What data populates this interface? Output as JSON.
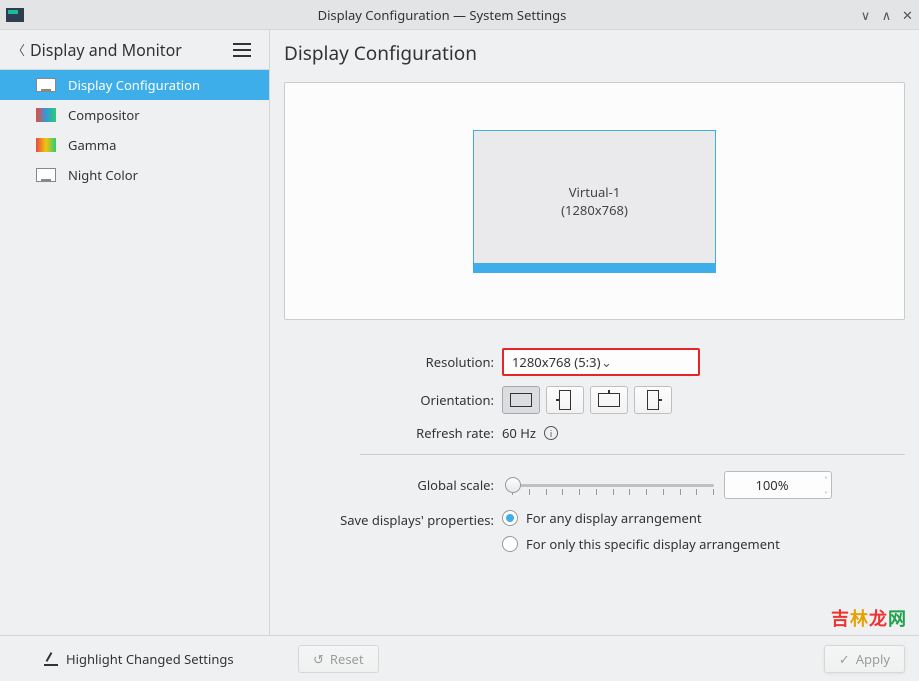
{
  "window": {
    "title": "Display Configuration — System Settings"
  },
  "sidebar": {
    "title": "Display and Monitor",
    "items": [
      {
        "label": "Display Configuration"
      },
      {
        "label": "Compositor"
      },
      {
        "label": "Gamma"
      },
      {
        "label": "Night Color"
      }
    ]
  },
  "content": {
    "heading": "Display Configuration",
    "monitor": {
      "name": "Virtual-1",
      "resolution": "(1280x768)"
    },
    "labels": {
      "resolution": "Resolution:",
      "orientation": "Orientation:",
      "refresh": "Refresh rate:",
      "scale": "Global scale:",
      "save": "Save displays' properties:"
    },
    "resolution_value": "1280x768 (5:3)",
    "refresh_value": "60 Hz",
    "scale_value": "100%",
    "radio": {
      "any": "For any display arrangement",
      "specific": "For only this specific display arrangement"
    }
  },
  "footer": {
    "highlight": "Highlight Changed Settings",
    "reset": "Reset",
    "apply": "Apply"
  },
  "watermark": "吉林龙网"
}
